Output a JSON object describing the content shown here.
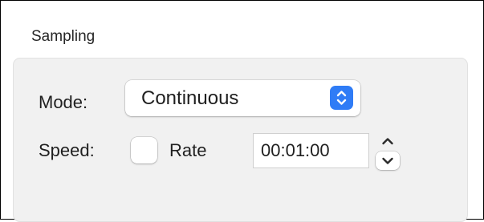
{
  "section": {
    "title": "Sampling"
  },
  "mode": {
    "label": "Mode:",
    "selected": "Continuous",
    "icon": "updown-chevron-icon",
    "accent_color": "#2f7cf6"
  },
  "speed": {
    "label": "Speed:",
    "rate_checkbox": {
      "label": "Rate",
      "checked": false
    },
    "time_value": "00:01:00",
    "stepper_icons": [
      "chevron-up-icon",
      "chevron-down-icon"
    ]
  }
}
